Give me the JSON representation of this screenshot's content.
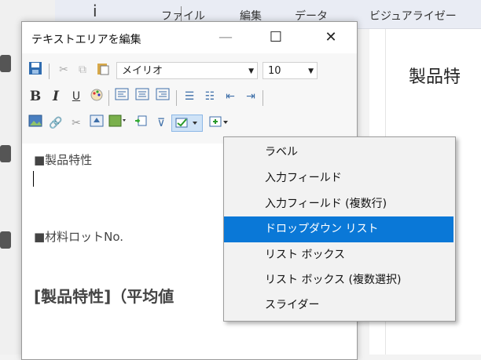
{
  "background": {
    "menubar": [
      "ファイル",
      "編集",
      "データ",
      "ビジュアライゼー"
    ],
    "main_title": "製品特"
  },
  "dialog": {
    "title": "テキストエリアを編集",
    "minimize": "—",
    "maximize": "☐",
    "close": "✕"
  },
  "toolbar": {
    "font_name": "メイリオ",
    "font_size": "10",
    "bold": "B",
    "italic": "I",
    "underline": "U"
  },
  "editor": {
    "line1": "■製品特性",
    "line2": "■材料ロットNo.",
    "heading": "[製品特性]（平均値"
  },
  "menu": {
    "items": [
      {
        "label": "ラベル",
        "selected": false
      },
      {
        "label": "入力フィールド",
        "selected": false
      },
      {
        "label": "入力フィールド (複数行)",
        "selected": false
      },
      {
        "label": "ドロップダウン リスト",
        "selected": true
      },
      {
        "label": "リスト ボックス",
        "selected": false
      },
      {
        "label": "リスト ボックス (複数選択)",
        "selected": false
      },
      {
        "label": "スライダー",
        "selected": false
      }
    ]
  }
}
